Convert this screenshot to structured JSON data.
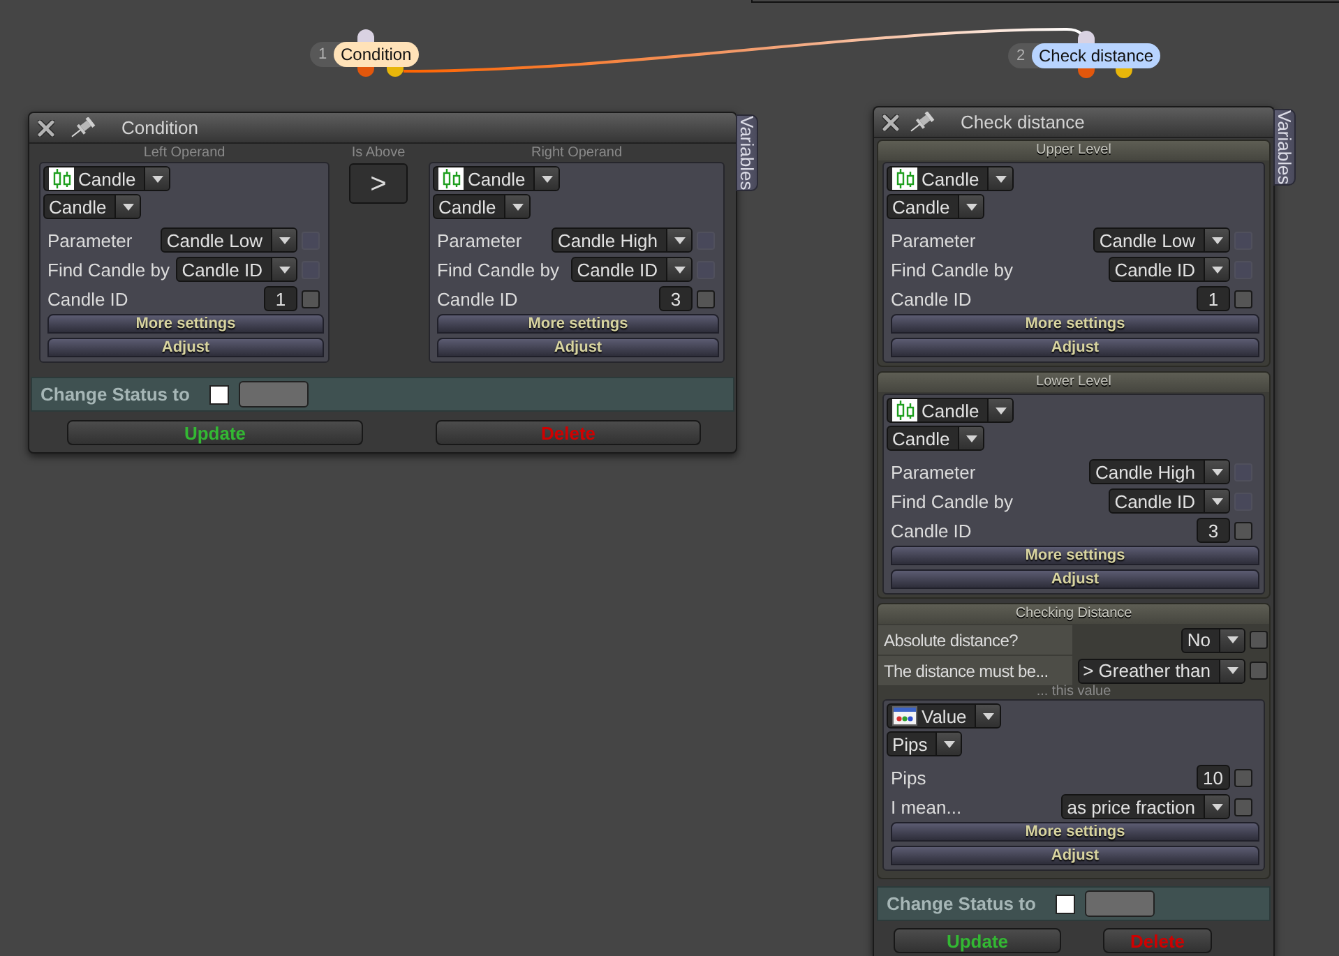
{
  "canvas_nodes": [
    {
      "number": "1",
      "label": "Condition",
      "color": "#ffe2b8"
    },
    {
      "number": "2",
      "label": "Check distance",
      "color": "#b8d4ff"
    }
  ],
  "windows": [
    {
      "kind": "condition",
      "title": "Condition",
      "side_tab": "Variables",
      "operator": {
        "caption": "Is Above",
        "symbol": ">"
      },
      "operands": [
        {
          "caption": "Left Operand",
          "source": {
            "kind": "candle",
            "value": "Candle"
          },
          "subtype": "Candle",
          "rows": [
            {
              "kind": "select",
              "label": "Parameter",
              "value": "Candle Low",
              "checkbox": {
                "checked": false,
                "disabled": true
              }
            },
            {
              "kind": "select",
              "label": "Find Candle by",
              "value": "Candle ID",
              "checkbox": {
                "checked": false,
                "disabled": true
              }
            },
            {
              "kind": "input",
              "label": "Candle ID",
              "value": "1",
              "checkbox": {
                "checked": false,
                "disabled": false
              }
            }
          ],
          "buttons": [
            "More settings",
            "Adjust"
          ]
        },
        {
          "caption": "Right Operand",
          "source": {
            "kind": "candle",
            "value": "Candle"
          },
          "subtype": "Candle",
          "rows": [
            {
              "kind": "select",
              "label": "Parameter",
              "value": "Candle High",
              "checkbox": {
                "checked": false,
                "disabled": true
              }
            },
            {
              "kind": "select",
              "label": "Find Candle by",
              "value": "Candle ID",
              "checkbox": {
                "checked": false,
                "disabled": true
              }
            },
            {
              "kind": "input",
              "label": "Candle ID",
              "value": "3",
              "checkbox": {
                "checked": false,
                "disabled": false
              }
            }
          ],
          "buttons": [
            "More settings",
            "Adjust"
          ]
        }
      ],
      "change_status": {
        "label": "Change Status to",
        "checked": false
      },
      "buttons": [
        {
          "kind": "update",
          "label": "Update"
        },
        {
          "kind": "delete",
          "label": "Delete"
        }
      ]
    },
    {
      "kind": "distance",
      "title": "Check distance",
      "side_tab": "Variables",
      "sections": [
        {
          "kind": "operand",
          "caption": "Upper Level",
          "operand": {
            "source": {
              "kind": "candle",
              "value": "Candle"
            },
            "subtype": "Candle",
            "rows": [
              {
                "kind": "select",
                "label": "Parameter",
                "value": "Candle Low",
                "checkbox": {
                  "checked": false,
                  "disabled": true
                }
              },
              {
                "kind": "select",
                "label": "Find Candle by",
                "value": "Candle ID",
                "checkbox": {
                  "checked": false,
                  "disabled": true
                }
              },
              {
                "kind": "input",
                "label": "Candle ID",
                "value": "1",
                "checkbox": {
                  "checked": false,
                  "disabled": false
                }
              }
            ],
            "buttons": [
              "More settings",
              "Adjust"
            ]
          }
        },
        {
          "kind": "operand",
          "caption": "Lower Level",
          "operand": {
            "source": {
              "kind": "candle",
              "value": "Candle"
            },
            "subtype": "Candle",
            "rows": [
              {
                "kind": "select",
                "label": "Parameter",
                "value": "Candle High",
                "checkbox": {
                  "checked": false,
                  "disabled": true
                }
              },
              {
                "kind": "select",
                "label": "Find Candle by",
                "value": "Candle ID",
                "checkbox": {
                  "checked": false,
                  "disabled": true
                }
              },
              {
                "kind": "input",
                "label": "Candle ID",
                "value": "3",
                "checkbox": {
                  "checked": false,
                  "disabled": false
                }
              }
            ],
            "buttons": [
              "More settings",
              "Adjust"
            ]
          }
        },
        {
          "kind": "options",
          "caption": "Checking Distance",
          "rows": [
            {
              "label": "Absolute distance?",
              "value": "No",
              "checkbox": {
                "checked": false,
                "disabled": false
              }
            },
            {
              "label": "The distance must be...",
              "value": "> Greather than",
              "checkbox": {
                "checked": false,
                "disabled": false
              }
            }
          ],
          "value_caption": "... this value",
          "operand": {
            "source": {
              "kind": "value",
              "value": "Value"
            },
            "subtype": "Pips",
            "rows": [
              {
                "kind": "input",
                "label": "Pips",
                "value": "10",
                "checkbox": {
                  "checked": false,
                  "disabled": false
                }
              },
              {
                "kind": "select",
                "label": "I mean...",
                "value": "as price fraction",
                "checkbox": {
                  "checked": false,
                  "disabled": false
                }
              }
            ],
            "buttons": [
              "More settings",
              "Adjust"
            ]
          }
        }
      ],
      "change_status": {
        "label": "Change Status to",
        "checked": false
      },
      "buttons": [
        {
          "kind": "update",
          "label": "Update"
        },
        {
          "kind": "delete",
          "label": "Delete"
        }
      ]
    }
  ]
}
